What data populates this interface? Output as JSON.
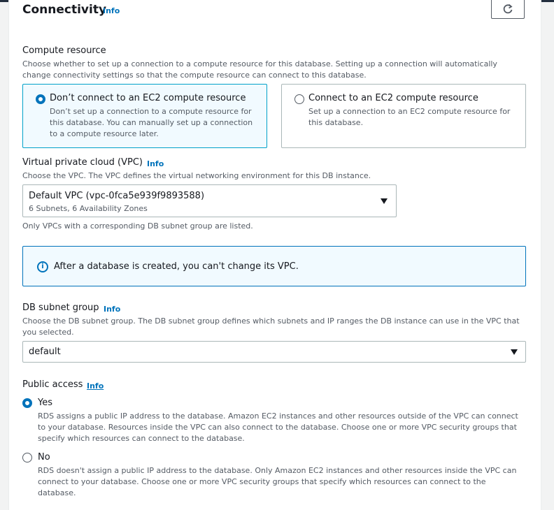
{
  "section": {
    "title": "Connectivity",
    "info": "Info"
  },
  "compute": {
    "label": "Compute resource",
    "description": "Choose whether to set up a connection to a compute resource for this database. Setting up a connection will automatically change connectivity settings so that the compute resource can connect to this database.",
    "options": [
      {
        "title": "Don’t connect to an EC2 compute resource",
        "description": "Don’t set up a connection to a compute resource for this database. You can manually set up a connection to a compute resource later.",
        "selected": true
      },
      {
        "title": "Connect to an EC2 compute resource",
        "description": "Set up a connection to an EC2 compute resource for this database.",
        "selected": false
      }
    ]
  },
  "vpc": {
    "label": "Virtual private cloud (VPC)",
    "info": "Info",
    "description": "Choose the VPC. The VPC defines the virtual networking environment for this DB instance.",
    "selected": "Default VPC (vpc-0fca5e939f9893588)",
    "selected_detail": "6 Subnets, 6 Availability Zones",
    "hint": "Only VPCs with a corresponding DB subnet group are listed."
  },
  "alert": {
    "text": "After a database is created, you can't change its VPC.",
    "icon": "info-circle-icon"
  },
  "subnet": {
    "label": "DB subnet group",
    "info": "Info",
    "description": "Choose the DB subnet group. The DB subnet group defines which subnets and IP ranges the DB instance can use in the VPC that you selected.",
    "selected": "default"
  },
  "public_access": {
    "label": "Public access",
    "info": "Info",
    "options": [
      {
        "title": "Yes",
        "description": "RDS assigns a public IP address to the database. Amazon EC2 instances and other resources outside of the VPC can connect to your database. Resources inside the VPC can also connect to the database. Choose one or more VPC security groups that specify which resources can connect to the database.",
        "selected": true
      },
      {
        "title": "No",
        "description": "RDS doesn't assign a public IP address to the database. Only Amazon EC2 instances and other resources inside the VPC can connect to your database. Choose one or more VPC security groups that specify which resources can connect to the database.",
        "selected": false
      }
    ]
  },
  "colors": {
    "accent": "#0073bb",
    "selected_bg": "#f1faff",
    "border": "#aab7b8",
    "muted_text": "#545b64"
  }
}
